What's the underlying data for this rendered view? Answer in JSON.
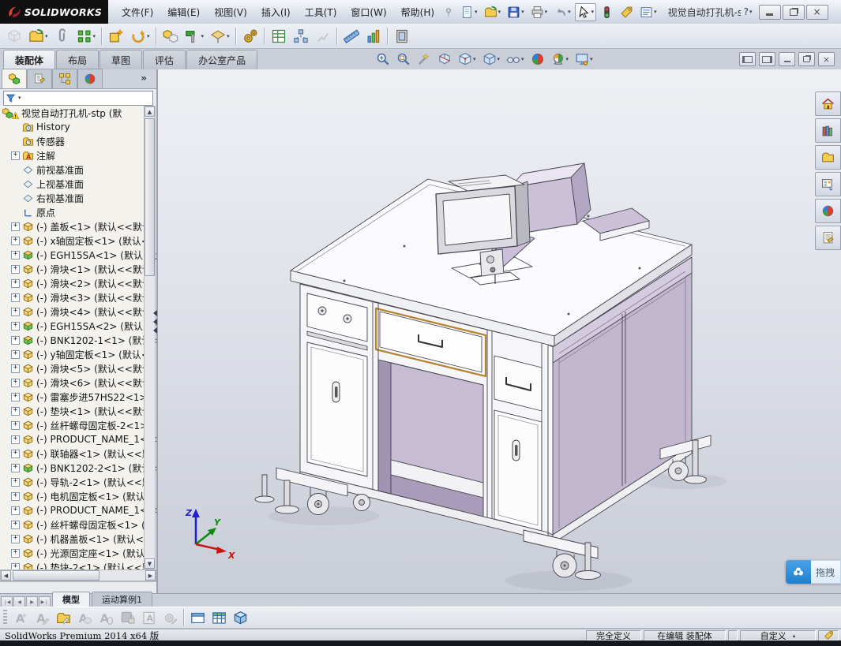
{
  "titlebar": {
    "brand": "SOLIDWORKS",
    "title": "视觉自动打孔机-st...",
    "menus": [
      "文件(F)",
      "编辑(E)",
      "视图(V)",
      "插入(I)",
      "工具(T)",
      "窗口(W)",
      "帮助(H)"
    ],
    "help_glyph": "?"
  },
  "command_tabs": {
    "items": [
      "装配体",
      "布局",
      "草图",
      "评估",
      "办公室产品"
    ],
    "active_index": 0
  },
  "model_tabs": {
    "items": [
      "模型",
      "运动算例1"
    ],
    "active_index": 0
  },
  "panel": {
    "more": "»"
  },
  "icon_rows": {
    "quick": [
      {
        "name": "new-document",
        "glyph": "page",
        "dd": true
      },
      {
        "name": "open-document",
        "glyph": "folderarrow",
        "dd": true
      },
      {
        "name": "save",
        "glyph": "disk",
        "dd": true
      },
      {
        "name": "print",
        "glyph": "printer",
        "dd": true
      },
      {
        "name": "undo",
        "glyph": "undo",
        "dd": true
      },
      {
        "name": "select",
        "glyph": "cursor",
        "dd": true,
        "boxed": true
      },
      {
        "name": "rebuild",
        "glyph": "traffic"
      },
      {
        "name": "file-properties",
        "glyph": "tag"
      },
      {
        "name": "options",
        "glyph": "list",
        "dd": true
      }
    ],
    "assembly": [
      {
        "name": "insert-components",
        "glyph": "cubegray",
        "disabled": true
      },
      {
        "name": "open-part",
        "glyph": "folderarrow",
        "dd": true
      },
      {
        "name": "mate",
        "glyph": "clip"
      },
      {
        "name": "linear-component-pattern",
        "glyph": "blocks",
        "dd": true,
        "sep": true
      },
      {
        "name": "smart-fasteners",
        "glyph": "starbox"
      },
      {
        "name": "move-component",
        "glyph": "movearrow",
        "dd": true,
        "sep": true
      },
      {
        "name": "show-hidden-components",
        "glyph": "hiddencomp"
      },
      {
        "name": "assembly-features",
        "glyph": "hammer",
        "dd": true
      },
      {
        "name": "reference-geometry",
        "glyph": "refgeom",
        "dd": true,
        "sep": true
      },
      {
        "name": "new-motion-study",
        "glyph": "gears",
        "sep": true
      },
      {
        "name": "bill-of-materials",
        "glyph": "bom"
      },
      {
        "name": "exploded-view",
        "glyph": "explode"
      },
      {
        "name": "explode-line-sketch",
        "glyph": "sketchexplode",
        "disabled": true,
        "sep": true
      },
      {
        "name": "interference-detection",
        "glyph": "ruler"
      },
      {
        "name": "assembly-visualization",
        "glyph": "vis",
        "sep": true
      },
      {
        "name": "instant3d",
        "glyph": "frame"
      }
    ],
    "headsup": [
      {
        "name": "zoom-to-fit",
        "glyph": "magfit"
      },
      {
        "name": "zoom-to-area",
        "glyph": "magarea"
      },
      {
        "name": "previous-view",
        "glyph": "wand"
      },
      {
        "name": "section-view",
        "glyph": "section"
      },
      {
        "name": "view-orientation",
        "glyph": "vieworient",
        "dd": true
      },
      {
        "name": "display-style",
        "glyph": "cube",
        "dd": true
      },
      {
        "name": "hide-show-items",
        "glyph": "glasses",
        "dd": true
      },
      {
        "name": "edit-appearance",
        "glyph": "sphere"
      },
      {
        "name": "apply-scene",
        "glyph": "spherelegs",
        "dd": true
      },
      {
        "name": "view-settings",
        "glyph": "monitorgear",
        "dd": true
      }
    ],
    "mgr": [
      {
        "name": "featuremanager-tab",
        "glyph": "asm",
        "active": true
      },
      {
        "name": "propertymanager-tab",
        "glyph": "property"
      },
      {
        "name": "configurationmanager-tab",
        "glyph": "config"
      },
      {
        "name": "displaymanager-tab",
        "glyph": "sphere"
      }
    ],
    "taskpane": [
      {
        "name": "solidworks-resources",
        "glyph": "home"
      },
      {
        "name": "design-library",
        "glyph": "books"
      },
      {
        "name": "file-explorer",
        "glyph": "folder"
      },
      {
        "name": "view-palette",
        "glyph": "palette"
      },
      {
        "name": "appearances-scenes",
        "glyph": "sphere"
      },
      {
        "name": "custom-properties",
        "glyph": "props"
      }
    ],
    "bottom": [
      {
        "name": "spell-check",
        "glyph": "noteA",
        "disabled": true
      },
      {
        "name": "edit-annotation",
        "glyph": "noteEdit",
        "disabled": true
      },
      {
        "name": "open-annotation-folder",
        "glyph": "folderEdit"
      },
      {
        "name": "annotation-to-3d",
        "glyph": "noteCube",
        "disabled": true
      },
      {
        "name": "select-annotation",
        "glyph": "noteMouse",
        "disabled": true
      },
      {
        "name": "save-table",
        "glyph": "diskLock",
        "disabled": true
      },
      {
        "name": "image-border",
        "glyph": "frameA",
        "disabled": true
      },
      {
        "name": "gear-edit",
        "glyph": "gearEdit",
        "disabled": true,
        "sep": true
      },
      {
        "name": "split-window",
        "glyph": "window"
      },
      {
        "name": "table-view",
        "glyph": "tableicon"
      },
      {
        "name": "view-3d",
        "glyph": "cube3d"
      }
    ]
  },
  "tree": {
    "root": {
      "label": "视觉自动打孔机-stp  (默"
    },
    "items": [
      {
        "g": "historyfolder",
        "label": "History"
      },
      {
        "g": "sensorfolder",
        "label": "传感器"
      },
      {
        "g": "afolder",
        "label": "注解",
        "exp": true
      },
      {
        "g": "plane",
        "label": "前视基准面"
      },
      {
        "g": "plane",
        "label": "上视基准面"
      },
      {
        "g": "plane",
        "label": "右视基准面"
      },
      {
        "g": "origin",
        "label": "原点"
      },
      {
        "g": "part",
        "label": "(-) 盖板<1> (默认<<默认",
        "exp": true
      },
      {
        "g": "part",
        "label": "(-) x轴固定板<1> (默认<",
        "exp": true
      },
      {
        "g": "subasm",
        "label": "(-) EGH15SA<1> (默认<默",
        "exp": true
      },
      {
        "g": "part",
        "label": "(-) 滑块<1> (默认<<默认",
        "exp": true
      },
      {
        "g": "part",
        "label": "(-) 滑块<2> (默认<<默认",
        "exp": true
      },
      {
        "g": "part",
        "label": "(-) 滑块<3> (默认<<默认",
        "exp": true
      },
      {
        "g": "part",
        "label": "(-) 滑块<4> (默认<<默认",
        "exp": true
      },
      {
        "g": "subasm",
        "label": "(-) EGH15SA<2> (默认<默",
        "exp": true
      },
      {
        "g": "subasm",
        "label": "(-) BNK1202-1<1> (默认<",
        "exp": true
      },
      {
        "g": "part",
        "label": "(-) y轴固定板<1> (默认<",
        "exp": true
      },
      {
        "g": "part",
        "label": "(-) 滑块<5> (默认<<默认",
        "exp": true
      },
      {
        "g": "part",
        "label": "(-) 滑块<6> (默认<<默认",
        "exp": true
      },
      {
        "g": "part",
        "label": "(-) 雷塞步进57HS22<1> (",
        "exp": true
      },
      {
        "g": "part",
        "label": "(-) 垫块<1> (默认<<默认",
        "exp": true
      },
      {
        "g": "part",
        "label": "(-) 丝杆螺母固定板-2<1>",
        "exp": true
      },
      {
        "g": "part",
        "label": "(-) PRODUCT_NAME_1<1> (",
        "exp": true
      },
      {
        "g": "part",
        "label": "(-) 联轴器<1> (默认<<默",
        "exp": true
      },
      {
        "g": "subasm",
        "label": "(-) BNK1202-2<1> (默认<",
        "exp": true
      },
      {
        "g": "part",
        "label": "(-) 导轨-2<1> (默认<<默",
        "exp": true
      },
      {
        "g": "part",
        "label": "(-) 电机固定板<1> (默认",
        "exp": true
      },
      {
        "g": "part",
        "label": "(-) PRODUCT_NAME_1<2> (",
        "exp": true
      },
      {
        "g": "part",
        "label": "(-) 丝杆螺母固定板<1> (",
        "exp": true
      },
      {
        "g": "part",
        "label": "(-) 机器盖板<1> (默认<<",
        "exp": true
      },
      {
        "g": "part",
        "label": "(-) 光源固定座<1> (默认",
        "exp": true
      },
      {
        "g": "part",
        "label": "(-) 垫块-2<1> (默认<<默",
        "exp": true
      },
      {
        "g": "part",
        "label": "",
        "exp": true
      }
    ]
  },
  "status": {
    "left": "SolidWorks Premium 2014 x64 版",
    "seg1": "完全定义",
    "seg2": "在编辑  装配体",
    "seg3": "自定义"
  },
  "overlay": {
    "label": "拖拽"
  },
  "triad": {
    "x": "X",
    "y": "Y",
    "z": "Z"
  },
  "colors": {
    "drawer_highlight": "#b5832e",
    "desk_lavender": "#c3b7cf",
    "netdisk_blue": "#1f7fd0"
  }
}
